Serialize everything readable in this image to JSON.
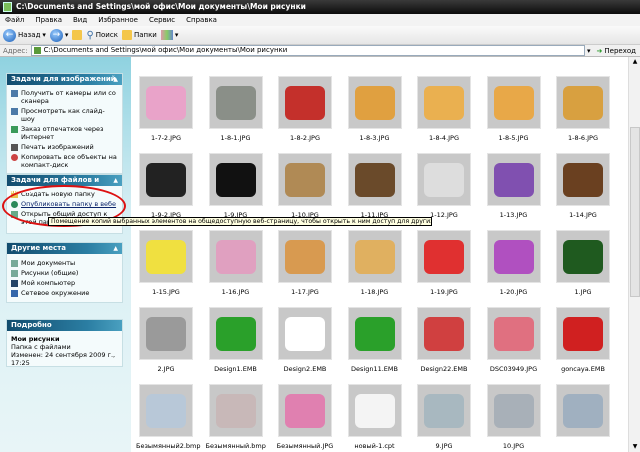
{
  "window": {
    "title": "C:\\Documents and Settings\\мой офис\\Мои документы\\Мои рисунки"
  },
  "menu": [
    "Файл",
    "Правка",
    "Вид",
    "Избранное",
    "Сервис",
    "Справка"
  ],
  "toolbar": {
    "back": "Назад",
    "search": "Поиск",
    "folders": "Папки"
  },
  "address": {
    "label": "Адрес:",
    "value": "C:\\Documents and Settings\\мой офис\\Мои документы\\Мои рисунки",
    "go": "Переход"
  },
  "sidebar": {
    "image_tasks": {
      "title": "Задачи для изображений",
      "items": [
        "Получить от камеры или со сканера",
        "Просмотреть как слайд-шоу",
        "Заказ отпечатков через Интернет",
        "Печать изображений",
        "Копировать все объекты на компакт-диск"
      ]
    },
    "file_tasks": {
      "title": "Задачи для файлов и папок",
      "items": [
        "Создать новую папку",
        "Опубликовать папку в вебе",
        "Открыть общий доступ к этой папке"
      ]
    },
    "other_places": {
      "title": "Другие места",
      "items": [
        "Мои документы",
        "Рисунки (общие)",
        "Мой компьютер",
        "Сетевое окружение"
      ]
    },
    "details": {
      "title": "Подробно",
      "name": "Мои рисунки",
      "type": "Папка с файлами",
      "modified": "Изменен: 24 сентября 2009 г., 17:25"
    }
  },
  "tooltip": "Помещение копий выбранных элементов на общедоступную веб-страницу, чтобы открыть к ним доступ для других пользователей.",
  "accent": {
    "highlight": "#dd1111",
    "panel_header": "#124c6e"
  },
  "files": [
    {
      "name": "1-7-2.JPG",
      "color": "#e9a3c9"
    },
    {
      "name": "1-8-1.JPG",
      "color": "#8a8f88"
    },
    {
      "name": "1-8-2.JPG",
      "color": "#c4302b"
    },
    {
      "name": "1-8-3.JPG",
      "color": "#e0a040"
    },
    {
      "name": "1-8-4.JPG",
      "color": "#eab050"
    },
    {
      "name": "1-8-5.JPG",
      "color": "#e8a848"
    },
    {
      "name": "1-8-6.JPG",
      "color": "#d8a040"
    },
    {
      "name": "1-9-2.JPG",
      "color": "#222222"
    },
    {
      "name": "1-9.JPG",
      "color": "#111111"
    },
    {
      "name": "1-10.JPG",
      "color": "#b08a55"
    },
    {
      "name": "1-11.JPG",
      "color": "#6a4a2a"
    },
    {
      "name": "1-12.JPG",
      "color": "#dddddd"
    },
    {
      "name": "1-13.JPG",
      "color": "#8050b0"
    },
    {
      "name": "1-14.JPG",
      "color": "#6a4020"
    },
    {
      "name": "1-15.JPG",
      "color": "#f0e040"
    },
    {
      "name": "1-16.JPG",
      "color": "#e0a0c0"
    },
    {
      "name": "1-17.JPG",
      "color": "#d89a50"
    },
    {
      "name": "1-18.JPG",
      "color": "#e0b060"
    },
    {
      "name": "1-19.JPG",
      "color": "#e03030"
    },
    {
      "name": "1-20.JPG",
      "color": "#b050c0"
    },
    {
      "name": "1.JPG",
      "color": "#1f5a1f"
    },
    {
      "name": "2.JPG",
      "color": "#9a9a9a"
    },
    {
      "name": "Design1.EMB",
      "color": "#2aa02a"
    },
    {
      "name": "Design2.EMB",
      "color": "#ffffff"
    },
    {
      "name": "Design11.EMB",
      "color": "#2aa02a"
    },
    {
      "name": "Design22.EMB",
      "color": "#d04040"
    },
    {
      "name": "DSC03949.JPG",
      "color": "#e07080"
    },
    {
      "name": "goncaya.EMB",
      "color": "#d02020"
    },
    {
      "name": "Безымянный2.bmp",
      "color": "#b8c8d8"
    },
    {
      "name": "Безымянный.bmp",
      "color": "#c8b8b8"
    },
    {
      "name": "Безымянный.JPG",
      "color": "#e080b0"
    },
    {
      "name": "новый-1.cpt",
      "color": "#f4f4f4"
    },
    {
      "name": "9.JPG",
      "color": "#a8b8c0"
    },
    {
      "name": "10.JPG",
      "color": "#a8b0b8"
    },
    {
      "name": "",
      "color": "#a0b0c0"
    }
  ]
}
